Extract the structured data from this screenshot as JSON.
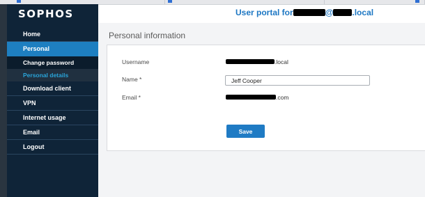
{
  "brand": {
    "logo_text": "SOPHOS"
  },
  "header": {
    "title_prefix": "User portal for",
    "title_at": "@",
    "title_suffix": ".local"
  },
  "sidebar": {
    "items": [
      {
        "label": "Home"
      },
      {
        "label": "Personal"
      },
      {
        "label": "Change password"
      },
      {
        "label": "Personal details"
      },
      {
        "label": "Download client"
      },
      {
        "label": "VPN"
      },
      {
        "label": "Internet usage"
      },
      {
        "label": "Email"
      },
      {
        "label": "Logout"
      }
    ]
  },
  "main": {
    "section_title": "Personal information",
    "username_label": "Username",
    "username_suffix": ".local",
    "name_label": "Name *",
    "name_value": "Jeff Cooper",
    "email_label": "Email *",
    "email_suffix": ".com",
    "save_label": "Save"
  },
  "colors": {
    "accent": "#1e7fc1",
    "sidebar_bg": "#0f2438",
    "title": "#1d77c3",
    "selected_sub": "#29a3d8"
  }
}
